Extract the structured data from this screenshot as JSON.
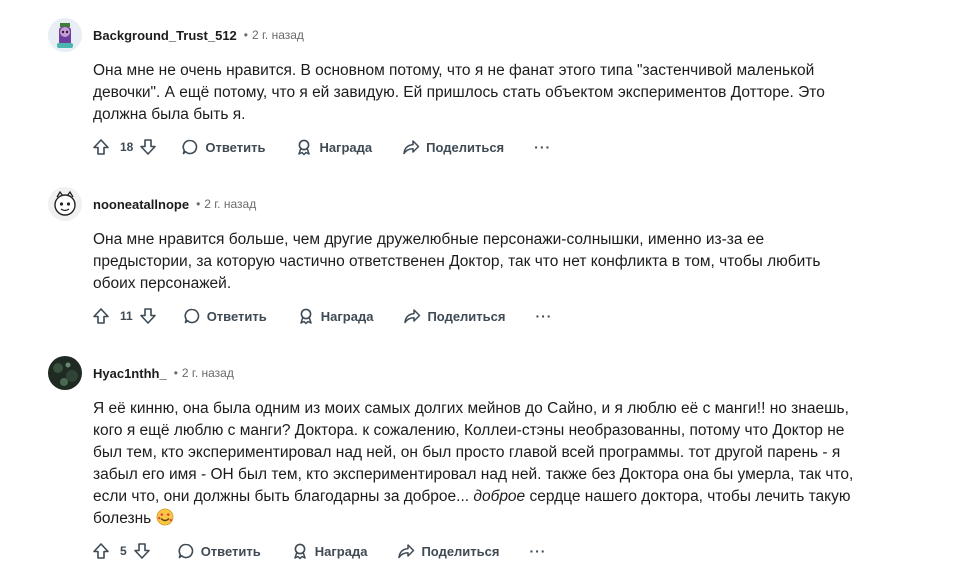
{
  "comments": [
    {
      "username": "Background_Trust_512",
      "dot": "•",
      "time": "2 г. назад",
      "lines": [
        "Она мне не очень нравится. В основном потому, что я не фанат этого типа \"застенчивой маленькой",
        "девочки\". А ещё потому, что я ей завидую. Ей пришлось стать объектом экспериментов Дотторе. Это",
        "должна была быть я."
      ],
      "votes": "18",
      "reply_label": "Ответить",
      "award_label": "Награда",
      "share_label": "Поделиться",
      "more_label": "···"
    },
    {
      "username": "nooneatallnope",
      "dot": "•",
      "time": "2 г. назад",
      "lines": [
        "Она мне нравится больше, чем другие дружелюбные персонажи-солнышки, именно из-за ее",
        "предыстории, за которую частично ответственен Доктор, так что нет конфликта в том, чтобы любить",
        "обоих персонажей."
      ],
      "votes": "11",
      "reply_label": "Ответить",
      "award_label": "Награда",
      "share_label": "Поделиться",
      "more_label": "···"
    },
    {
      "username": "Hyac1nthh_",
      "dot": "•",
      "time": "2 г. назад",
      "lines": [
        "Я её кинню, она была одним из моих самых долгих мейнов до Сайно, и я люблю её с манги!! но знаешь,",
        "кого я ещё люблю с манги? Доктора. к сожалению, Коллеи-стэны необразованны, потому что Доктор не",
        "был тем, кто экспериментировал над ней, он был просто главой всей программы. тот другой парень - я",
        "забыл его имя - ОН был тем, кто экспериментировал над ней. также без Доктора она бы умерла, так что,"
      ],
      "last_line_before": "если что, они должны быть благодарны за доброе... ",
      "last_line_italic": "доброе",
      "last_line_after": " сердце нашего доктора, чтобы лечить такую",
      "final_line": "болезнь",
      "votes": "5",
      "reply_label": "Ответить",
      "award_label": "Награда",
      "share_label": "Поделиться",
      "more_label": "···"
    }
  ]
}
